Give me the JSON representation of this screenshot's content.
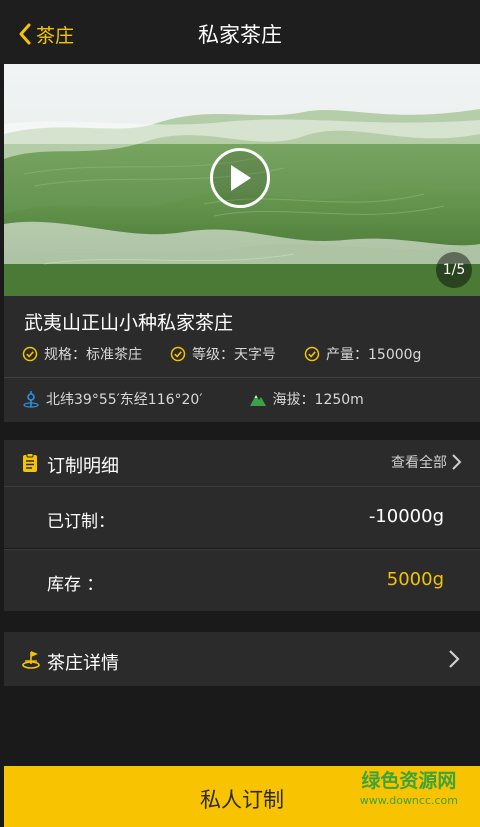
{
  "nav": {
    "back_label": "茶庄",
    "title": "私家茶庄"
  },
  "hero": {
    "page_indicator": "1/5"
  },
  "estate": {
    "name": "武夷山正山小种私家茶庄",
    "specs": [
      {
        "label": "规格：标准茶庄"
      },
      {
        "label": "等级：天字号"
      },
      {
        "label": "产量：15000g"
      }
    ],
    "coordinates": "北纬39°55′东经116°20′",
    "altitude": "海拔：1250m"
  },
  "order": {
    "title": "订制明细",
    "view_all": "查看全部",
    "rows": [
      {
        "label": "已订制：",
        "value": "-10000g"
      },
      {
        "label": "库存 ：",
        "value": "5000g"
      }
    ]
  },
  "detail": {
    "title": "茶庄详情"
  },
  "cta": {
    "label": "私人订制"
  },
  "watermark": {
    "line1": "绿色资源网",
    "line2": "www.downcc.com"
  },
  "colors": {
    "accent": "#f8c300",
    "panel": "#2b2b2c",
    "background": "#1a1a1b",
    "watermark": "#3fa33a"
  },
  "icons": {
    "back": "chevron-left-icon",
    "play": "play-icon",
    "spec": "check-circle-icon",
    "location": "location-pin-icon",
    "altitude": "mountain-icon",
    "order": "clipboard-icon",
    "detail": "estate-icon",
    "chevron": "chevron-right-icon"
  }
}
